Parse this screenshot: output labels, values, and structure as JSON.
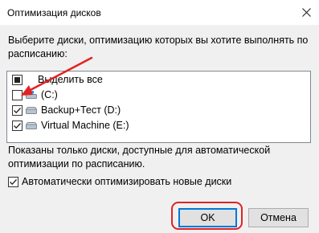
{
  "window": {
    "title": "Оптимизация дисков",
    "close_icon": "close-icon"
  },
  "prompt": "Выберите диски, оптимизацию которых вы хотите выполнять по расписанию:",
  "drive_list": {
    "select_all": {
      "label": "Выделить все",
      "state": "indeterminate"
    },
    "items": [
      {
        "label": "(C:)",
        "checked": false,
        "icon": "windows-drive-icon"
      },
      {
        "label": "Backup+Тест (D:)",
        "checked": true,
        "icon": "drive-icon"
      },
      {
        "label": "Virtual Machine (E:)",
        "checked": true,
        "icon": "drive-icon"
      }
    ]
  },
  "note": "Показаны только диски, доступные для автоматической оптимизации по расписанию.",
  "auto_optimize": {
    "label": "Автоматически оптимизировать новые диски",
    "checked": true
  },
  "buttons": {
    "ok": "OK",
    "cancel": "Отмена"
  },
  "colors": {
    "annotation": "#e02424",
    "accent": "#0078d7"
  }
}
